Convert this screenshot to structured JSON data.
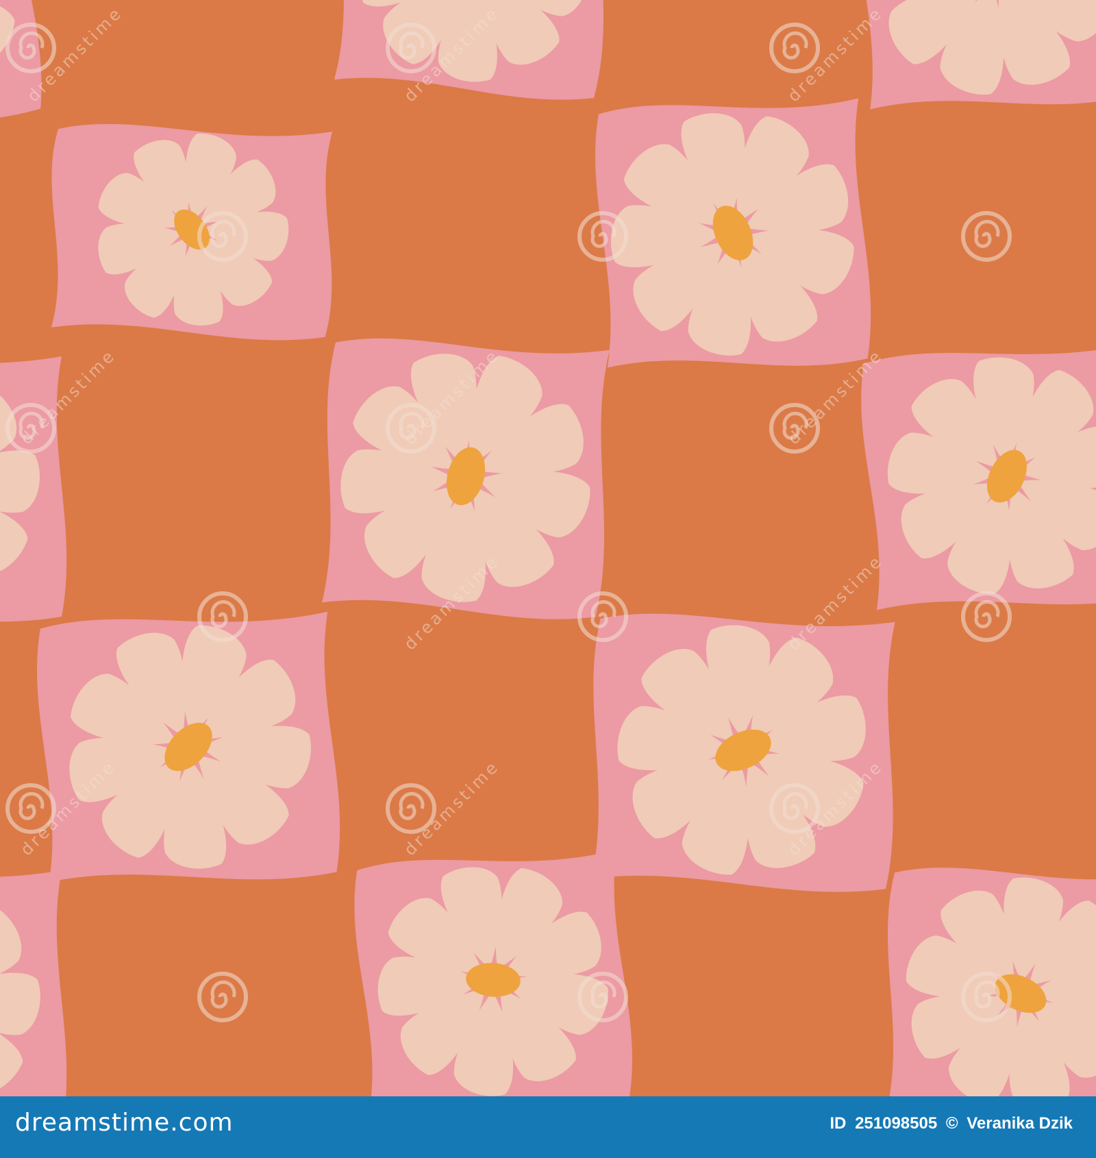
{
  "image": {
    "description_colors": {
      "background": "#db7a47",
      "tile_border": "#ec9aa3",
      "petal": "#f0cbb7",
      "flower_center": "#efa33e",
      "footer": "#1579b6"
    },
    "icon": "daisy-flower-icon"
  },
  "watermark": {
    "brand": "dreamstime.com",
    "repeated_text": "dreamstime",
    "logo_icon": "spiral-logo-icon"
  },
  "footer": {
    "brand": "dreamstime.com",
    "id_label": "ID",
    "id_value": "251098505",
    "copyright_symbol": "©",
    "author": "Veranika Dzik"
  }
}
